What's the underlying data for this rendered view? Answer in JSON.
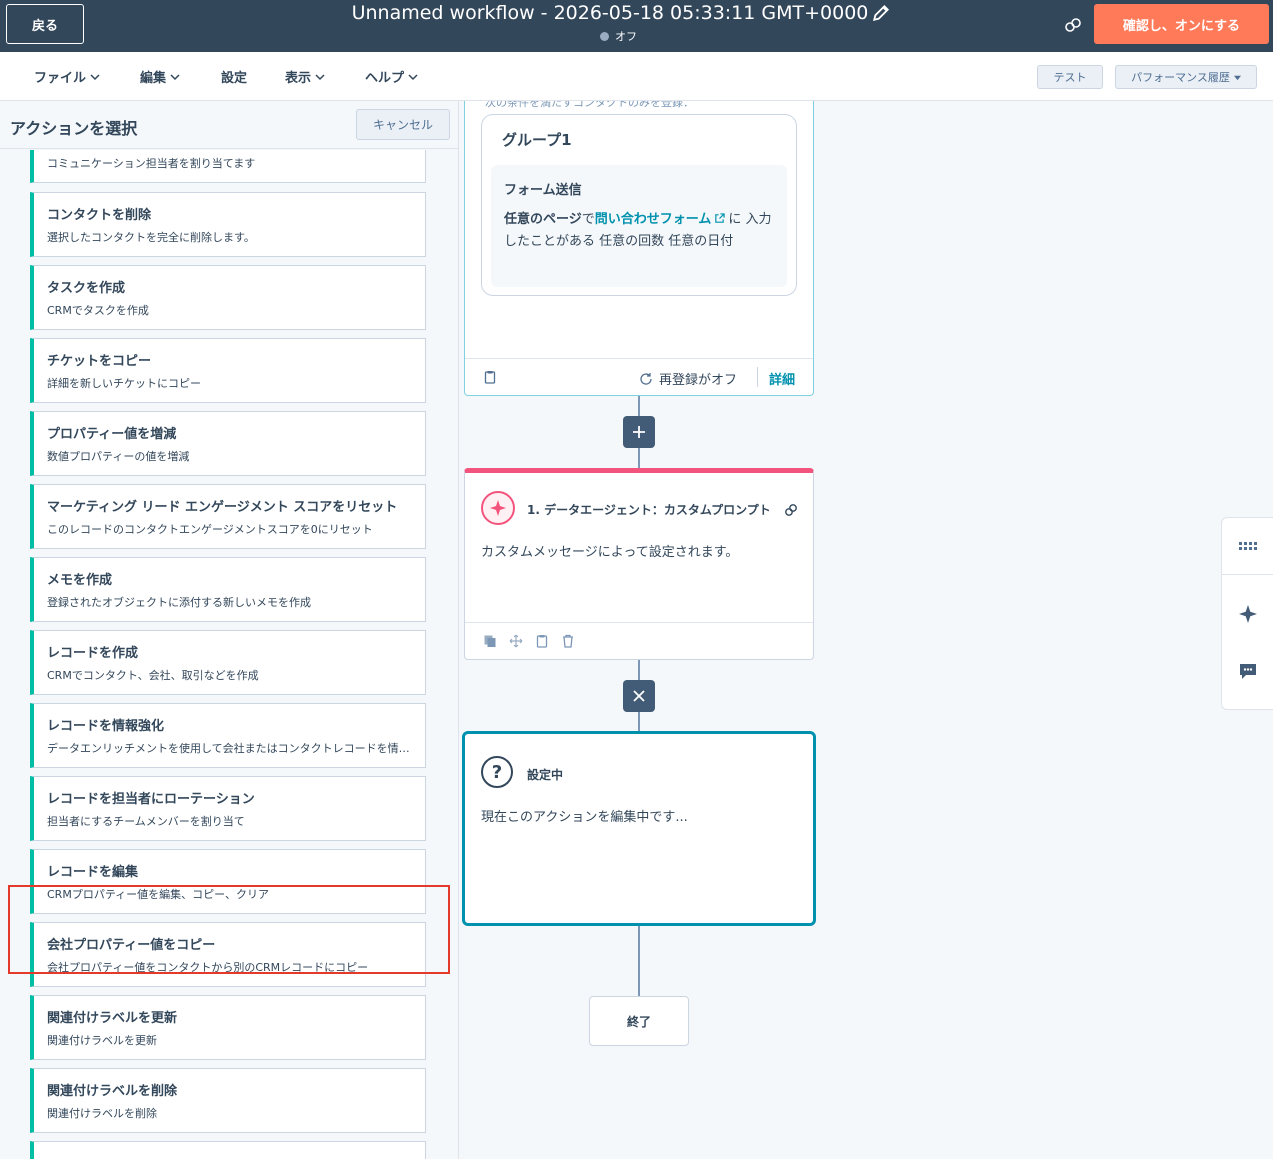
{
  "header": {
    "back_label": "戻る",
    "workflow_title": "Unnamed workflow - 2026-05-18 05:33:11 GMT+0000",
    "status": "オフ",
    "confirm_label": "確認し、オンにする"
  },
  "menu": {
    "file": "ファイル",
    "edit": "編集",
    "settings": "設定",
    "view": "表示",
    "help": "ヘルプ",
    "test": "テスト",
    "performance": "パフォーマンス履歴"
  },
  "panel": {
    "title": "アクションを選択",
    "cancel_label": "キャンセル",
    "actions": [
      {
        "title": "",
        "desc": "コミュニケーション担当者を割り当てます"
      },
      {
        "title": "コンタクトを削除",
        "desc": "選択したコンタクトを完全に削除します。"
      },
      {
        "title": "タスクを作成",
        "desc": "CRMでタスクを作成"
      },
      {
        "title": "チケットをコピー",
        "desc": "詳細を新しいチケットにコピー"
      },
      {
        "title": "プロパティー値を増減",
        "desc": "数値プロパティーの値を増減"
      },
      {
        "title": "マーケティング リード エンゲージメント スコアをリセット",
        "desc": "このレコードのコンタクトエンゲージメントスコアを0にリセット"
      },
      {
        "title": "メモを作成",
        "desc": "登録されたオブジェクトに添付する新しいメモを作成"
      },
      {
        "title": "レコードを作成",
        "desc": "CRMでコンタクト、会社、取引などを作成"
      },
      {
        "title": "レコードを情報強化",
        "desc": "データエンリッチメントを使用して会社またはコンタクトレコードを情報強化"
      },
      {
        "title": "レコードを担当者にローテーション",
        "desc": "担当者にするチームメンバーを割り当て"
      },
      {
        "title": "レコードを編集",
        "desc": "CRMプロパティー値を編集、コピー、クリア"
      },
      {
        "title": "会社プロパティー値をコピー",
        "desc": "会社プロパティー値をコンタクトから別のCRMレコードにコピー"
      },
      {
        "title": "関連付けラベルを更新",
        "desc": "関連付けラベルを更新"
      },
      {
        "title": "関連付けラベルを削除",
        "desc": "関連付けラベルを削除"
      },
      {
        "title": "",
        "desc": ""
      }
    ]
  },
  "trigger": {
    "partial_text": "次の条件を満たすコンタクトのみを登録：",
    "group_title": "グループ1",
    "cond_title": "フォーム送信",
    "cond_page": "任意のページ",
    "cond_de": "で",
    "cond_link": "問い合わせフォーム",
    "cond_ni": "に",
    "cond_rest": "入力したことがある 任意の回数 任意の日付",
    "reenroll": "再登録がオフ",
    "detail": "詳細"
  },
  "agent": {
    "title": "1. データエージェント：カスタムプロンプト",
    "body": "カスタムメッセージによって設定されます。"
  },
  "setting": {
    "title": "設定中",
    "body": "現在このアクションを編集中です..."
  },
  "end_label": "終了",
  "icons": [
    "edit-icon",
    "link-icon",
    "chevron-down-icon",
    "external-link-icon",
    "clipboard-icon",
    "refresh-icon",
    "plus-icon",
    "sparkle-icon",
    "copy-icon",
    "move-icon",
    "trash-icon",
    "close-icon",
    "question-icon",
    "grid-icon",
    "chat-icon"
  ],
  "colors": {
    "header_bg": "#33475b",
    "accent_orange": "#ff7a59",
    "teal": "#00bda5",
    "link_blue": "#0091ae",
    "agent_pink": "#f2547d",
    "highlight_red": "#e33a2b"
  }
}
